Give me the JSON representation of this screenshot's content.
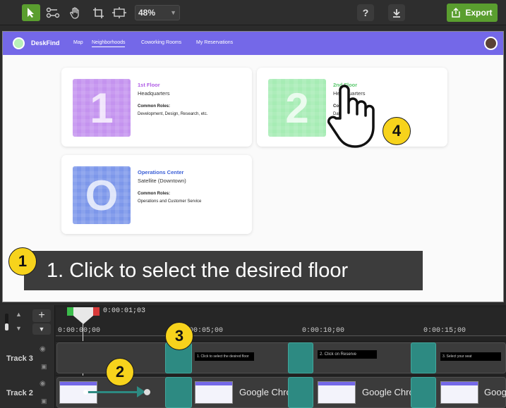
{
  "toolbar": {
    "zoom_value": "48%",
    "help_label": "?",
    "export_label": "Export",
    "accent_color": "#5a9e2f"
  },
  "app": {
    "brand": "DeskFind",
    "nav": [
      "Map",
      "Neighborhoods",
      "Coworking Rooms",
      "My Reservations"
    ],
    "nav_active": "Neighborhoods",
    "nav_color": "#7468e8"
  },
  "cards": [
    {
      "tile_label": "1",
      "title": "1st Floor",
      "subtitle": "Headquarters",
      "roles_label": "Common Roles:",
      "roles": "Development, Design, Research, etc.",
      "color": "#c493ef",
      "title_color": "#b05ce6"
    },
    {
      "tile_label": "2",
      "title": "2nd Floor",
      "subtitle": "Headquarters",
      "roles_label": "Common Roles:",
      "roles": "Data Science, etc.",
      "color": "#a6ecb4",
      "title_color": "#5cc96f"
    },
    {
      "tile_label": "O",
      "title": "Operations Center",
      "subtitle": "Satellite (Downtown)",
      "roles_label": "Common Roles:",
      "roles": "Operations and Customer Service",
      "color": "#7d97ea",
      "title_color": "#3b5fd6"
    }
  ],
  "caption": {
    "text": "1. Click to select the desired floor"
  },
  "callouts": {
    "c1": "1",
    "c2": "2",
    "c3": "3",
    "c4": "4"
  },
  "timeline": {
    "playhead_time": "0:00:01;03",
    "ruler": [
      "0:00:00;00",
      "0:00:05;00",
      "0:00:10;00",
      "0:00:15;00"
    ],
    "tracks": [
      "Track 3",
      "Track 2"
    ],
    "track2_clip_label": "Google Chror",
    "track3_captions": [
      "1. Click to select the desired floor",
      "2. Click on Reserve",
      "3. Select your seat"
    ]
  }
}
